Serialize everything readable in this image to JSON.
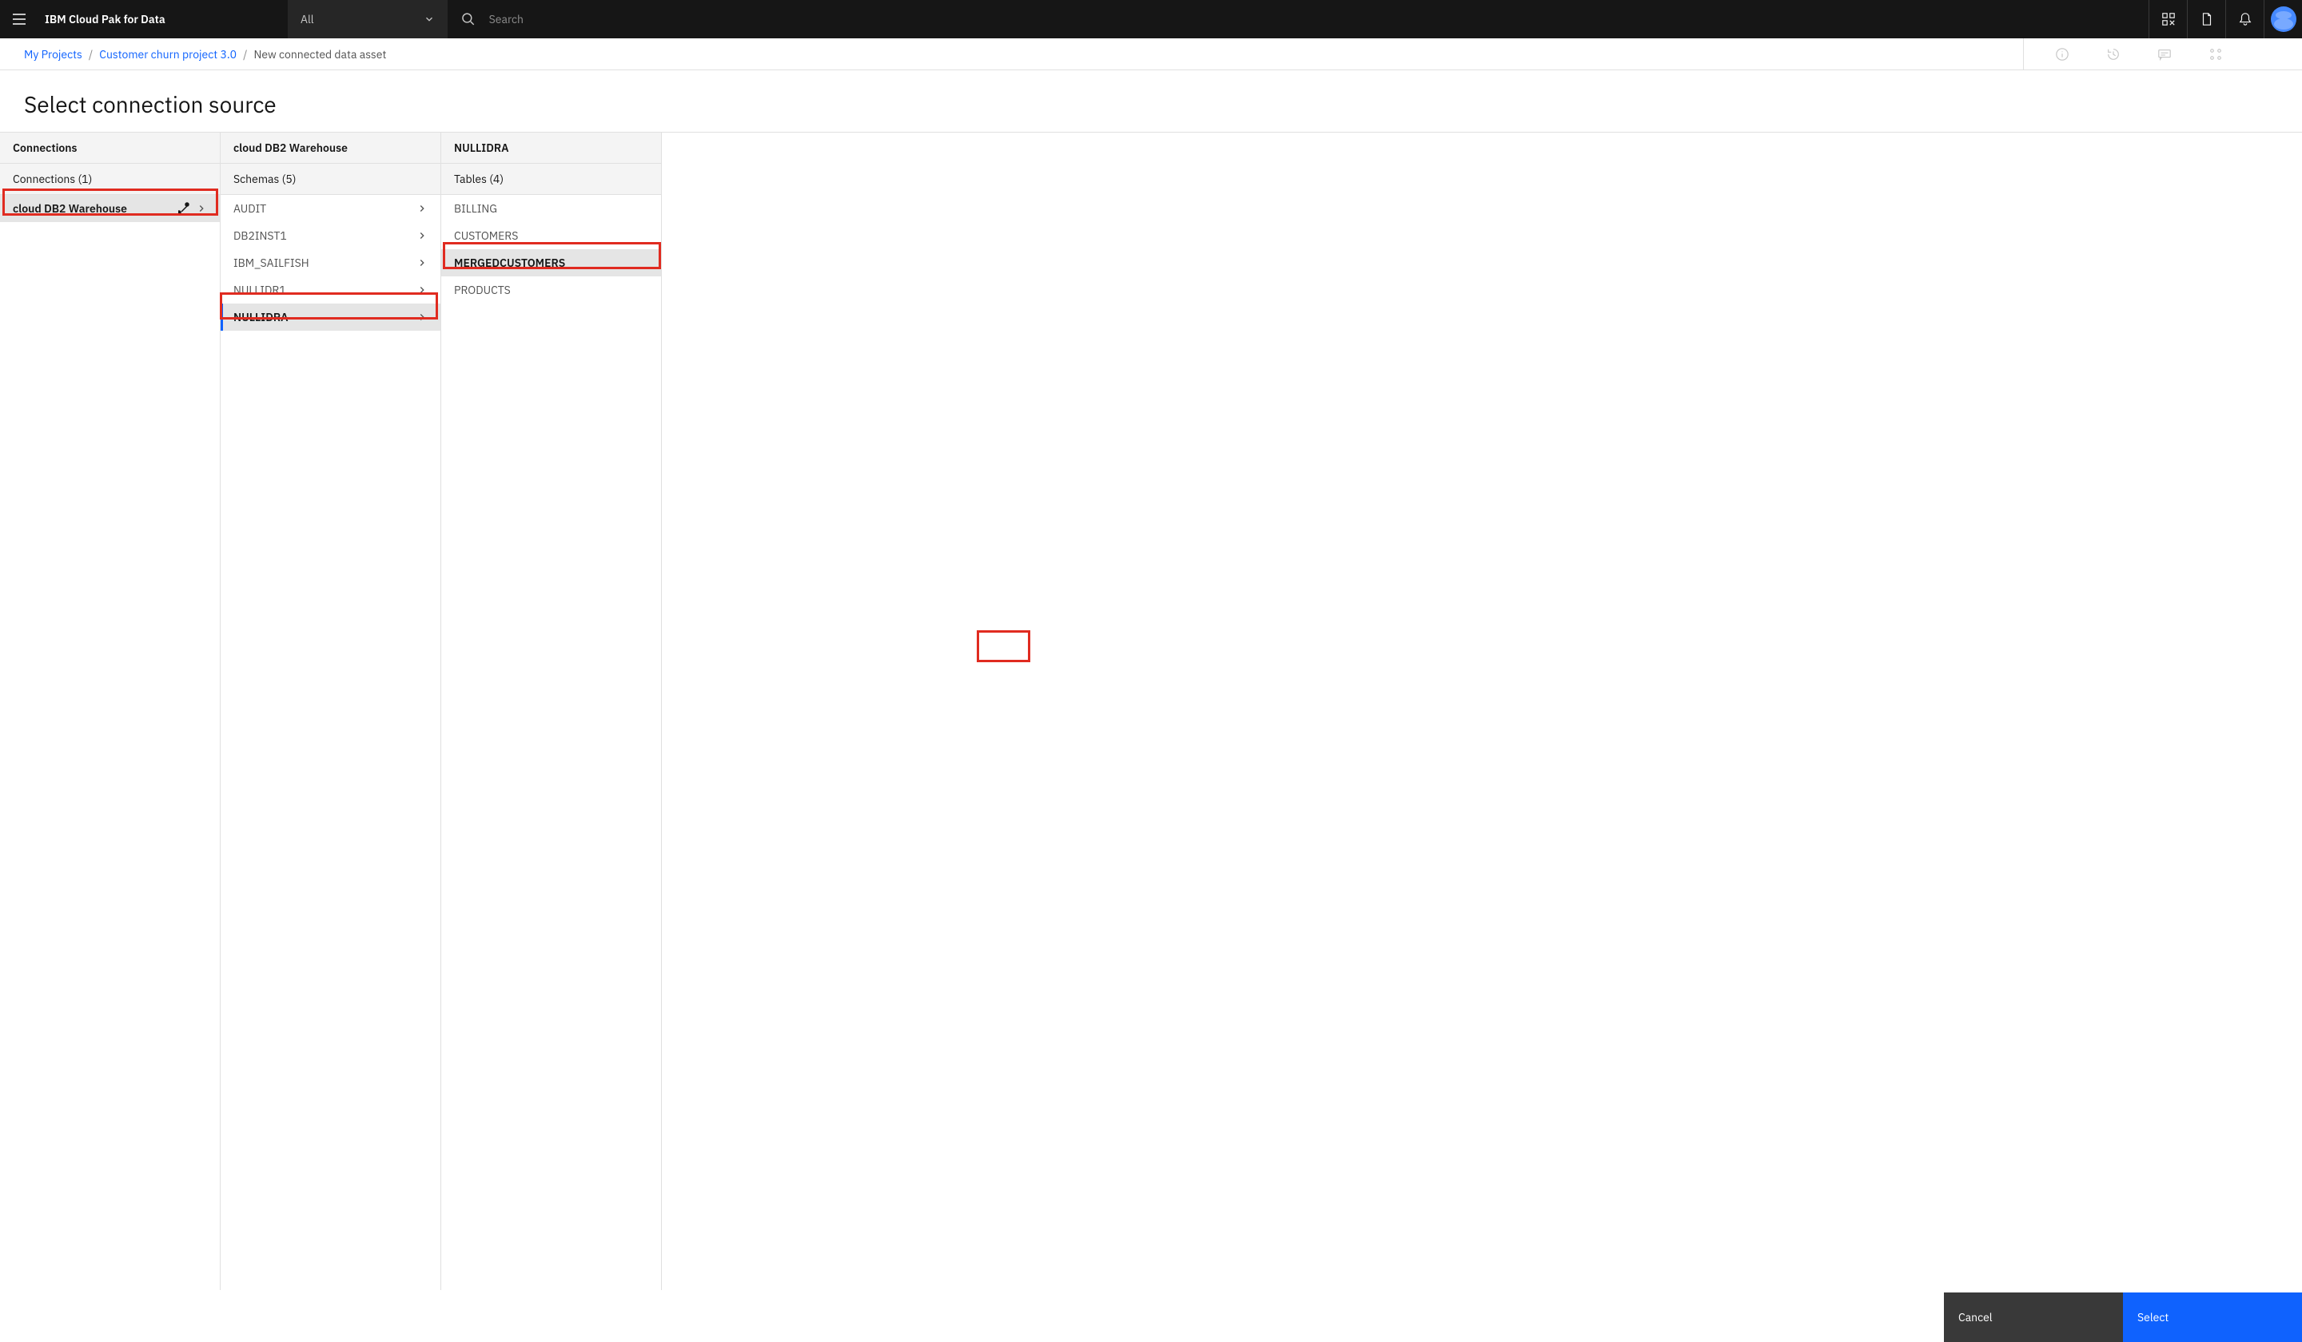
{
  "topbar": {
    "product": "IBM Cloud Pak for Data",
    "filter_label": "All",
    "search_placeholder": "Search"
  },
  "breadcrumb": {
    "items": [
      {
        "label": "My Projects",
        "link": true
      },
      {
        "label": "Customer churn project 3.0",
        "link": true
      },
      {
        "label": "New connected data asset",
        "link": false
      }
    ]
  },
  "page": {
    "title": "Select connection source"
  },
  "columns": {
    "col1": {
      "header": "Connections",
      "subheader": "Connections (1)",
      "items": [
        {
          "label": "cloud DB2 Warehouse",
          "selected": true,
          "connectorIcon": true
        }
      ]
    },
    "col2": {
      "header": "cloud DB2 Warehouse",
      "subheader": "Schemas (5)",
      "items": [
        {
          "label": "AUDIT",
          "selected": false
        },
        {
          "label": "DB2INST1",
          "selected": false
        },
        {
          "label": "IBM_SAILFISH",
          "selected": false
        },
        {
          "label": "NULLIDR1",
          "selected": false
        },
        {
          "label": "NULLIDRA",
          "selected": true
        }
      ]
    },
    "col3": {
      "header": "NULLIDRA",
      "subheader": "Tables (4)",
      "items": [
        {
          "label": "BILLING",
          "selected": false
        },
        {
          "label": "CUSTOMERS",
          "selected": false
        },
        {
          "label": "MERGEDCUSTOMERS",
          "selected": true
        },
        {
          "label": "PRODUCTS",
          "selected": false
        }
      ]
    }
  },
  "footer": {
    "cancel": "Cancel",
    "select": "Select"
  }
}
